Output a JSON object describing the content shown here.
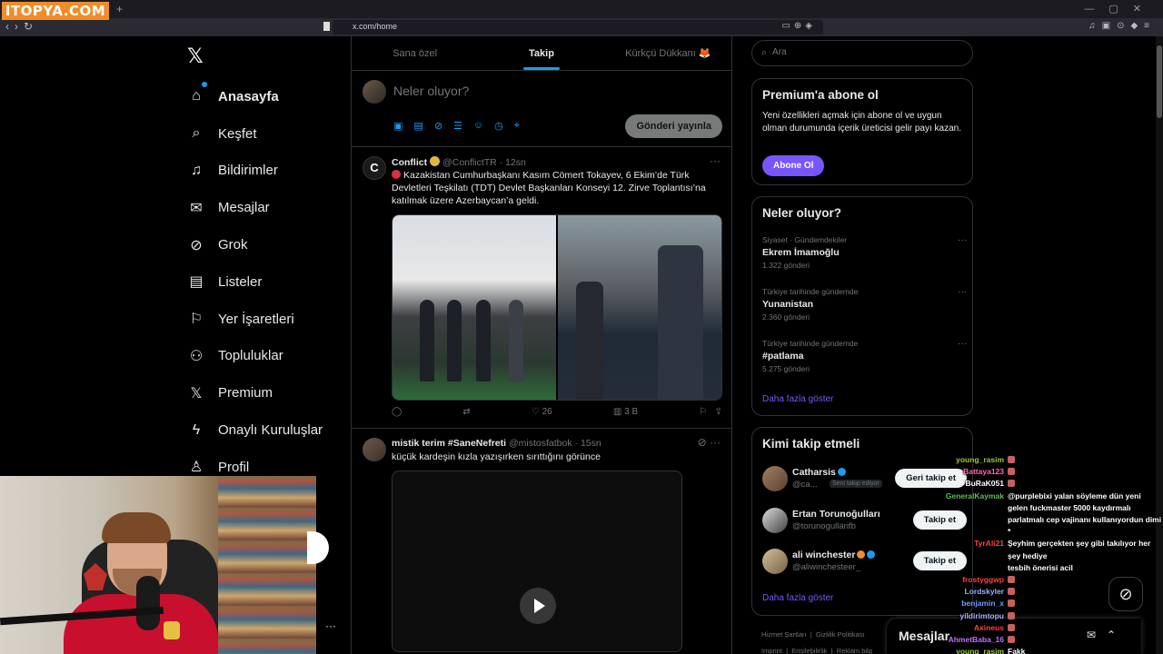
{
  "browser": {
    "brand": "ITOPYA.COM",
    "url": "x.com/home"
  },
  "nav": {
    "items": [
      {
        "label": "Anasayfa",
        "icon": "home-icon"
      },
      {
        "label": "Keşfet",
        "icon": "search-icon"
      },
      {
        "label": "Bildirimler",
        "icon": "bell-icon"
      },
      {
        "label": "Mesajlar",
        "icon": "mail-icon"
      },
      {
        "label": "Grok",
        "icon": "grok-icon"
      },
      {
        "label": "Listeler",
        "icon": "list-icon"
      },
      {
        "label": "Yer İşaretleri",
        "icon": "bookmark-icon"
      },
      {
        "label": "Topluluklar",
        "icon": "people-icon"
      },
      {
        "label": "Premium",
        "icon": "x-logo-icon"
      },
      {
        "label": "Onaylı Kuruluşlar",
        "icon": "bolt-icon"
      },
      {
        "label": "Profil",
        "icon": "user-icon"
      }
    ]
  },
  "timeline": {
    "tabs": [
      "Sana özel",
      "Takip",
      "Kürkçü Dükkanı 🦊"
    ],
    "composer_placeholder": "Neler oluyor?",
    "post_label": "Gönderi yayınla",
    "tweets": [
      {
        "name": "Conflict",
        "handle": "@ConflictTR",
        "time": "12sn",
        "text": "Kazakistan Cumhurbaşkanı Kasım Cömert Tokayev, 6 Ekim’de Türk Devletleri Teşkilatı (TDT) Devlet Başkanları Konseyi 12. Zirve Toplantısı’na katılmak üzere Azerbaycan’a geldi.",
        "likes": "26",
        "views": "3 B"
      },
      {
        "name": "mistik terim #SaneNefreti",
        "handle": "@mistosfatbok",
        "time": "15sn",
        "text": "küçük kardeşin kızla yazışırken sırıttığını görünce"
      }
    ]
  },
  "search": {
    "placeholder": "Ara"
  },
  "premium": {
    "title": "Premium'a abone ol",
    "text": "Yeni özellikleri açmak için abone ol ve uygun olman durumunda içerik üreticisi gelir payı kazan.",
    "button": "Abone Ol"
  },
  "trends": {
    "title": "Neler oluyor?",
    "items": [
      {
        "category": "Siyaset · Gündemdekiler",
        "name": "Ekrem İmamoğlu",
        "count": "1.322 gönderi"
      },
      {
        "category": "Türkiye tarihinde gündemde",
        "name": "Yunanistan",
        "count": "2.360 gönderi"
      },
      {
        "category": "Türkiye tarihinde gündemde",
        "name": "#patlama",
        "count": "5.275 gönderi"
      }
    ],
    "show_more": "Daha fazla göster"
  },
  "who_to_follow": {
    "title": "Kimi takip etmeli",
    "items": [
      {
        "name": "Catharsis",
        "handle": "@ca...",
        "badge": "Seni takip ediyor",
        "button": "Geri takip et"
      },
      {
        "name": "Ertan Torunoğulları",
        "handle": "@torunogullarifb",
        "button": "Takip et"
      },
      {
        "name": "ali winchester",
        "handle": "@aliwinchesteer_",
        "button": "Takip et"
      }
    ],
    "show_more": "Daha fazla göster"
  },
  "footer": {
    "links": [
      "Hizmet Şartları",
      "Gizlilik Politikası",
      "Imprint",
      "Erişilebilirlik",
      "Reklam bilg"
    ]
  },
  "messages_dock": {
    "label": "Mesajlar"
  },
  "chat": [
    {
      "user": "young_rasim",
      "color": "#9acd32",
      "msg": ""
    },
    {
      "user": "Battaya123",
      "color": "#ff69b4",
      "msg": ""
    },
    {
      "user": "BuRaK051",
      "color": "#ffffff",
      "msg": ""
    },
    {
      "user": "GeneralKaymak",
      "color": "#5fb85f",
      "msg": "@purplebixi yalan söyleme dün yeni gelen fuckmaster 5000 kaydırmalı parlatmalı cep vajinanı kullanıyordun dimi *"
    },
    {
      "user": "TyrAli21",
      "color": "#ff4040",
      "msg": "Şeyhim gerçekten şey gibi takılıyor her şey hediye"
    },
    {
      "user": "",
      "color": "#ffffff",
      "msg": "tesbih önerisi acil"
    },
    {
      "user": "frostyggwp",
      "color": "#ff4040",
      "msg": ""
    },
    {
      "user": "Lordskyler",
      "color": "#9ab0ff",
      "msg": ""
    },
    {
      "user": "benjamin_x",
      "color": "#6aa0ff",
      "msg": ""
    },
    {
      "user": "yildirimtopu",
      "color": "#b0b0ff",
      "msg": ""
    },
    {
      "user": "Axineus",
      "color": "#ff4040",
      "msg": ""
    },
    {
      "user": "AhmetBaba_16",
      "color": "#c070ff",
      "msg": ""
    },
    {
      "user": "young_rasim",
      "color": "#9acd32",
      "msg": "Fakk"
    }
  ]
}
